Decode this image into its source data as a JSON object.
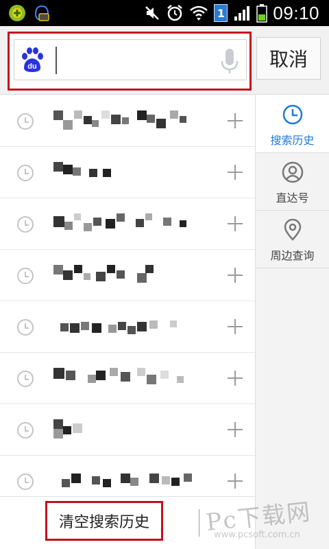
{
  "status_bar": {
    "time": "09:10",
    "sim_slot": "1",
    "icons": [
      "app-notification-icon",
      "chat-notification-icon",
      "mute-icon",
      "alarm-icon",
      "wifi-icon",
      "sim-icon",
      "signal-icon",
      "battery-icon"
    ]
  },
  "search": {
    "value": "",
    "logo_text": "du",
    "cancel_label": "取消"
  },
  "history": {
    "items": [
      {
        "blur_pattern": [
          [
            0,
            0,
            14,
            "#555"
          ],
          [
            14,
            14,
            14,
            "#999"
          ],
          [
            30,
            0,
            12,
            "#bbb"
          ],
          [
            44,
            8,
            12,
            "#333"
          ],
          [
            56,
            14,
            10,
            "#888"
          ],
          [
            70,
            0,
            12,
            "#ddd"
          ],
          [
            84,
            6,
            14,
            "#444"
          ],
          [
            100,
            10,
            10,
            "#777"
          ],
          [
            122,
            0,
            14,
            "#222"
          ],
          [
            136,
            6,
            12,
            "#666"
          ],
          [
            150,
            12,
            14,
            "#333"
          ],
          [
            170,
            0,
            12,
            "#aaa"
          ],
          [
            184,
            8,
            10,
            "#555"
          ]
        ]
      },
      {
        "blur_pattern": [
          [
            0,
            0,
            14,
            "#444"
          ],
          [
            14,
            4,
            14,
            "#222"
          ],
          [
            28,
            8,
            12,
            "#777"
          ],
          [
            52,
            10,
            12,
            "#333"
          ],
          [
            72,
            10,
            12,
            "#222"
          ]
        ]
      },
      {
        "blur_pattern": [
          [
            0,
            4,
            16,
            "#333"
          ],
          [
            16,
            12,
            12,
            "#888"
          ],
          [
            30,
            0,
            10,
            "#ccc"
          ],
          [
            44,
            14,
            12,
            "#999"
          ],
          [
            58,
            6,
            12,
            "#555"
          ],
          [
            76,
            8,
            14,
            "#222"
          ],
          [
            92,
            0,
            12,
            "#666"
          ],
          [
            120,
            8,
            12,
            "#444"
          ],
          [
            134,
            0,
            10,
            "#aaa"
          ],
          [
            160,
            6,
            12,
            "#777"
          ],
          [
            184,
            10,
            10,
            "#222"
          ]
        ]
      },
      {
        "blur_pattern": [
          [
            0,
            0,
            14,
            "#777"
          ],
          [
            14,
            8,
            14,
            "#333"
          ],
          [
            30,
            0,
            12,
            "#222"
          ],
          [
            44,
            12,
            10,
            "#aaa"
          ],
          [
            62,
            10,
            14,
            "#444"
          ],
          [
            78,
            0,
            12,
            "#222"
          ],
          [
            92,
            8,
            12,
            "#555"
          ],
          [
            122,
            12,
            14,
            "#666"
          ],
          [
            134,
            0,
            12,
            "#333"
          ]
        ]
      },
      {
        "blur_pattern": [
          [
            10,
            10,
            12,
            "#555"
          ],
          [
            24,
            10,
            14,
            "#333"
          ],
          [
            40,
            8,
            12,
            "#777"
          ],
          [
            56,
            10,
            14,
            "#222"
          ],
          [
            80,
            12,
            12,
            "#999"
          ],
          [
            94,
            8,
            12,
            "#444"
          ],
          [
            108,
            14,
            12,
            "#555"
          ],
          [
            122,
            8,
            14,
            "#333"
          ],
          [
            140,
            6,
            12,
            "#bbb"
          ],
          [
            170,
            6,
            10,
            "#ccc"
          ]
        ]
      },
      {
        "blur_pattern": [
          [
            0,
            0,
            16,
            "#333"
          ],
          [
            18,
            4,
            14,
            "#555"
          ],
          [
            50,
            10,
            12,
            "#999"
          ],
          [
            62,
            4,
            14,
            "#222"
          ],
          [
            82,
            0,
            12,
            "#aaa"
          ],
          [
            98,
            6,
            14,
            "#555"
          ],
          [
            122,
            0,
            12,
            "#ccc"
          ],
          [
            136,
            10,
            14,
            "#777"
          ],
          [
            156,
            4,
            12,
            "#ddd"
          ],
          [
            180,
            12,
            10,
            "#bbb"
          ]
        ]
      },
      {
        "blur_pattern": [
          [
            0,
            0,
            14,
            "#444"
          ],
          [
            14,
            10,
            12,
            "#222"
          ],
          [
            0,
            14,
            14,
            "#999"
          ],
          [
            28,
            6,
            14,
            "#ccc"
          ]
        ]
      },
      {
        "blur_pattern": [
          [
            12,
            12,
            12,
            "#555"
          ],
          [
            26,
            4,
            14,
            "#222"
          ],
          [
            56,
            8,
            12,
            "#555"
          ],
          [
            72,
            12,
            12,
            "#222"
          ],
          [
            98,
            4,
            14,
            "#333"
          ],
          [
            112,
            10,
            12,
            "#888"
          ],
          [
            140,
            4,
            14,
            "#444"
          ],
          [
            158,
            8,
            12,
            "#bbb"
          ],
          [
            172,
            10,
            12,
            "#222"
          ],
          [
            190,
            4,
            12,
            "#666"
          ]
        ]
      }
    ]
  },
  "tabs": [
    {
      "label": "搜索历史",
      "icon": "clock-icon",
      "active": true
    },
    {
      "label": "直达号",
      "icon": "person-icon",
      "active": false
    },
    {
      "label": "周边查询",
      "icon": "location-pin-icon",
      "active": false
    }
  ],
  "bottom": {
    "clear_label": "清空搜索历史"
  },
  "watermark": {
    "main": "Pc下载网",
    "sub": "www.pcsoft.com.cn"
  },
  "colors": {
    "accent": "#1f7ad8",
    "highlight_border": "#c3101f",
    "baidu_blue": "#2932e1"
  }
}
